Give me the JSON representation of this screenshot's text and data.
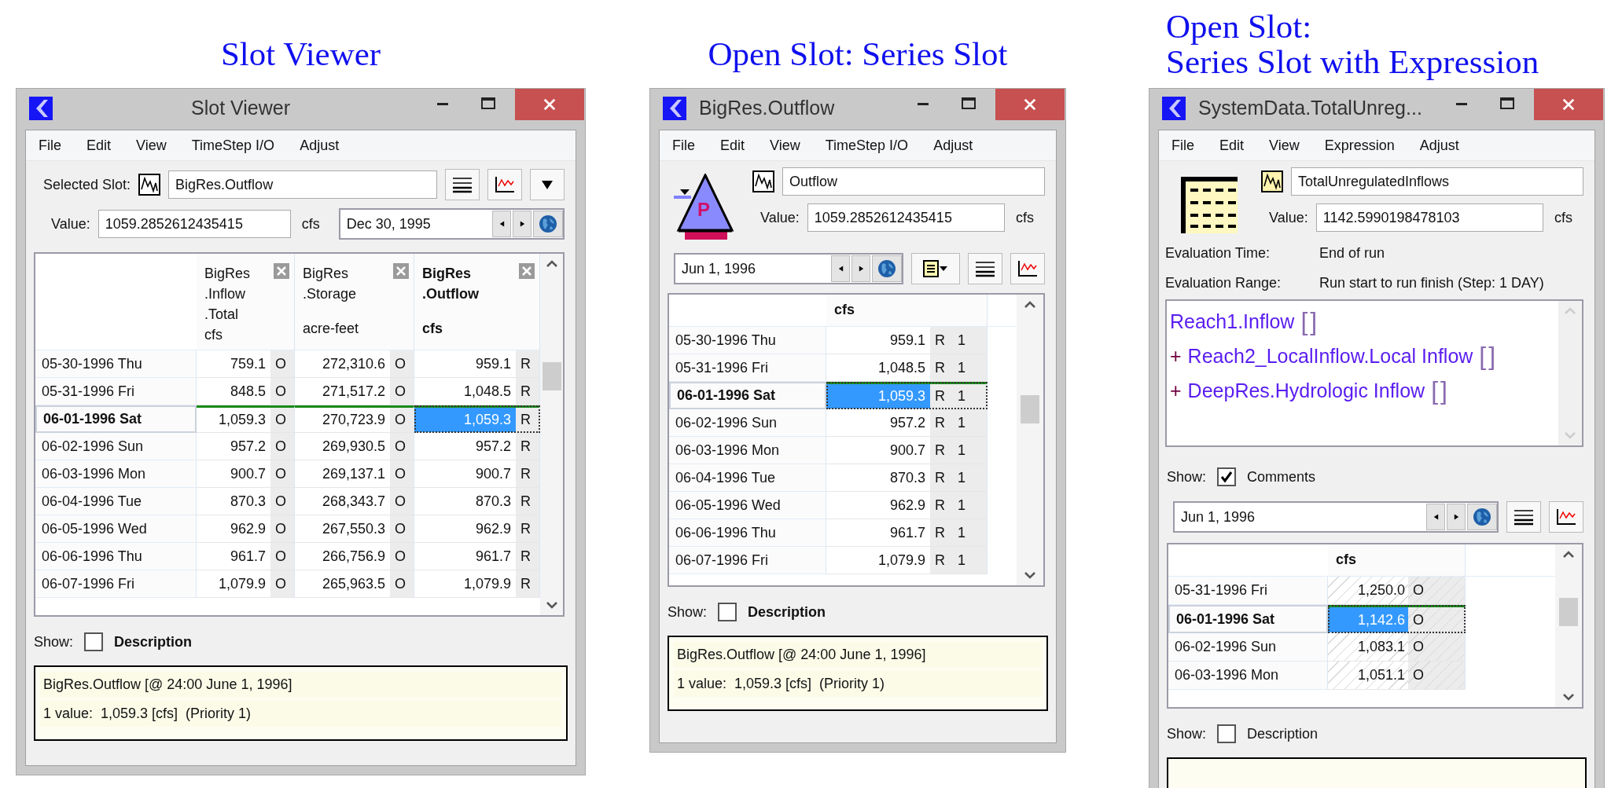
{
  "panels": [
    {
      "caption": [
        "Slot Viewer"
      ],
      "window": {
        "kind": "viewer",
        "title": "Slot Viewer",
        "menu": [
          "File",
          "Edit",
          "View",
          "TimeStep I/O",
          "Adjust"
        ],
        "slot": {
          "label": "Selected Slot:",
          "value": "BigRes.Outflow"
        },
        "value": {
          "label": "Value:",
          "value": "1059.2852612435415",
          "unit": "cfs"
        },
        "date": "Dec 30, 1995",
        "table": {
          "hatched": false,
          "columns": [
            {
              "lines": [
                "BigRes",
                ".Inflow",
                ".Total"
              ],
              "unit": "cfs",
              "selected": false
            },
            {
              "lines": [
                "BigRes",
                ".Storage"
              ],
              "unit": "acre-feet",
              "selected": false
            },
            {
              "lines": [
                "BigRes",
                ".Outflow"
              ],
              "unit": "cfs",
              "selected": true
            }
          ],
          "rows": [
            {
              "date": "05-30-1996 Thu",
              "current": false,
              "cells": [
                {
                  "value": "759.1",
                  "flag": "O",
                  "selected": false
                },
                {
                  "value": "272,310.6",
                  "flag": "O",
                  "selected": false
                },
                {
                  "value": "959.1",
                  "flag": "R",
                  "selected": false
                }
              ]
            },
            {
              "date": "05-31-1996 Fri",
              "current": false,
              "cells": [
                {
                  "value": "848.5",
                  "flag": "O",
                  "selected": false
                },
                {
                  "value": "271,517.2",
                  "flag": "O",
                  "selected": false
                },
                {
                  "value": "1,048.5",
                  "flag": "R",
                  "selected": false
                }
              ]
            },
            {
              "date": "06-01-1996 Sat",
              "current": true,
              "cells": [
                {
                  "value": "1,059.3",
                  "flag": "O",
                  "selected": false
                },
                {
                  "value": "270,723.9",
                  "flag": "O",
                  "selected": false
                },
                {
                  "value": "1,059.3",
                  "flag": "R",
                  "selected": true
                }
              ]
            },
            {
              "date": "06-02-1996 Sun",
              "current": false,
              "cells": [
                {
                  "value": "957.2",
                  "flag": "O",
                  "selected": false
                },
                {
                  "value": "269,930.5",
                  "flag": "O",
                  "selected": false
                },
                {
                  "value": "957.2",
                  "flag": "R",
                  "selected": false
                }
              ]
            },
            {
              "date": "06-03-1996 Mon",
              "current": false,
              "cells": [
                {
                  "value": "900.7",
                  "flag": "O",
                  "selected": false
                },
                {
                  "value": "269,137.1",
                  "flag": "O",
                  "selected": false
                },
                {
                  "value": "900.7",
                  "flag": "R",
                  "selected": false
                }
              ]
            },
            {
              "date": "06-04-1996 Tue",
              "current": false,
              "cells": [
                {
                  "value": "870.3",
                  "flag": "O",
                  "selected": false
                },
                {
                  "value": "268,343.7",
                  "flag": "O",
                  "selected": false
                },
                {
                  "value": "870.3",
                  "flag": "R",
                  "selected": false
                }
              ]
            },
            {
              "date": "06-05-1996 Wed",
              "current": false,
              "cells": [
                {
                  "value": "962.9",
                  "flag": "O",
                  "selected": false
                },
                {
                  "value": "267,550.3",
                  "flag": "O",
                  "selected": false
                },
                {
                  "value": "962.9",
                  "flag": "R",
                  "selected": false
                }
              ]
            },
            {
              "date": "06-06-1996 Thu",
              "current": false,
              "cells": [
                {
                  "value": "961.7",
                  "flag": "O",
                  "selected": false
                },
                {
                  "value": "266,756.9",
                  "flag": "O",
                  "selected": false
                },
                {
                  "value": "961.7",
                  "flag": "R",
                  "selected": false
                }
              ]
            },
            {
              "date": "06-07-1996 Fri",
              "current": false,
              "cells": [
                {
                  "value": "1,079.9",
                  "flag": "O",
                  "selected": false
                },
                {
                  "value": "265,963.5",
                  "flag": "O",
                  "selected": false
                },
                {
                  "value": "1,079.9",
                  "flag": "R",
                  "selected": false
                }
              ]
            }
          ]
        },
        "show": {
          "label": "Show:",
          "option": "Description",
          "checked": false
        },
        "info": [
          "BigRes.Outflow [@ 24:00 June 1, 1996]",
          "1 value:  1,059.3 [cfs]  (Priority 1)"
        ]
      }
    },
    {
      "caption": [
        "Open Slot: Series Slot"
      ],
      "window": {
        "kind": "series",
        "title": "BigRes.Outflow",
        "menu": [
          "File",
          "Edit",
          "View",
          "TimeStep I/O",
          "Adjust"
        ],
        "object_label": "P",
        "slot": {
          "value": "Outflow"
        },
        "value": {
          "label": "Value:",
          "value": "1059.2852612435415",
          "unit": "cfs"
        },
        "date": "Jun 1, 1996",
        "table": {
          "hatched": false,
          "columns": [
            {
              "unit": "cfs",
              "selected": true
            }
          ],
          "rows": [
            {
              "date": "05-30-1996 Thu",
              "current": false,
              "cells": [
                {
                  "value": "959.1",
                  "flag": "R",
                  "priority": "1",
                  "selected": false
                }
              ]
            },
            {
              "date": "05-31-1996 Fri",
              "current": false,
              "cells": [
                {
                  "value": "1,048.5",
                  "flag": "R",
                  "priority": "1",
                  "selected": false
                }
              ]
            },
            {
              "date": "06-01-1996 Sat",
              "current": true,
              "cells": [
                {
                  "value": "1,059.3",
                  "flag": "R",
                  "priority": "1",
                  "selected": true
                }
              ]
            },
            {
              "date": "06-02-1996 Sun",
              "current": false,
              "cells": [
                {
                  "value": "957.2",
                  "flag": "R",
                  "priority": "1",
                  "selected": false
                }
              ]
            },
            {
              "date": "06-03-1996 Mon",
              "current": false,
              "cells": [
                {
                  "value": "900.7",
                  "flag": "R",
                  "priority": "1",
                  "selected": false
                }
              ]
            },
            {
              "date": "06-04-1996 Tue",
              "current": false,
              "cells": [
                {
                  "value": "870.3",
                  "flag": "R",
                  "priority": "1",
                  "selected": false
                }
              ]
            },
            {
              "date": "06-05-1996 Wed",
              "current": false,
              "cells": [
                {
                  "value": "962.9",
                  "flag": "R",
                  "priority": "1",
                  "selected": false
                }
              ]
            },
            {
              "date": "06-06-1996 Thu",
              "current": false,
              "cells": [
                {
                  "value": "961.7",
                  "flag": "R",
                  "priority": "1",
                  "selected": false
                }
              ]
            },
            {
              "date": "06-07-1996 Fri",
              "current": false,
              "cells": [
                {
                  "value": "1,079.9",
                  "flag": "R",
                  "priority": "1",
                  "selected": false
                }
              ]
            }
          ]
        },
        "show": {
          "label": "Show:",
          "option": "Description",
          "checked": false
        },
        "info": [
          "BigRes.Outflow [@ 24:00 June 1, 1996]",
          "1 value:  1,059.3 [cfs]  (Priority 1)"
        ]
      }
    },
    {
      "caption": [
        "Open Slot:",
        "Series Slot with Expression"
      ],
      "window": {
        "kind": "expression",
        "title": "SystemData.TotalUnreg...",
        "menu": [
          "File",
          "Edit",
          "View",
          "Expression",
          "Adjust"
        ],
        "slot": {
          "value": "TotalUnregulatedInflows"
        },
        "value": {
          "label": "Value:",
          "value": "1142.5990198478103",
          "unit": "cfs"
        },
        "evaluation": [
          {
            "label": "Evaluation Time:",
            "value": "End of run"
          },
          {
            "label": "Evaluation Range:",
            "value": "Run start to run finish (Step: 1 DAY)"
          }
        ],
        "expression": [
          {
            "slot": "Reach1.Inflow",
            "brackets": "[]"
          },
          {
            "op": "+",
            "slot": "Reach2_LocalInflow.Local Inflow",
            "brackets": "[]"
          },
          {
            "op": "+",
            "slot": "DeepRes.Hydrologic Inflow",
            "brackets": "[]"
          }
        ],
        "comments": {
          "label": "Show:",
          "option": "Comments",
          "checked": true
        },
        "date": "Jun 1, 1996",
        "table": {
          "hatched": true,
          "columns": [
            {
              "unit": "cfs",
              "selected": true
            }
          ],
          "rows": [
            {
              "date": "05-31-1996 Fri",
              "current": false,
              "cells": [
                {
                  "value": "1,250.0",
                  "flag": "O",
                  "selected": false
                }
              ]
            },
            {
              "date": "06-01-1996 Sat",
              "current": true,
              "cells": [
                {
                  "value": "1,142.6",
                  "flag": "O",
                  "selected": true
                }
              ]
            },
            {
              "date": "06-02-1996 Sun",
              "current": false,
              "cells": [
                {
                  "value": "1,083.1",
                  "flag": "O",
                  "selected": false
                }
              ]
            },
            {
              "date": "06-03-1996 Mon",
              "current": false,
              "cells": [
                {
                  "value": "1,051.1",
                  "flag": "O",
                  "selected": false
                }
              ]
            }
          ]
        },
        "show": {
          "label": "Show:",
          "option": "Description",
          "checked": false
        }
      }
    }
  ]
}
